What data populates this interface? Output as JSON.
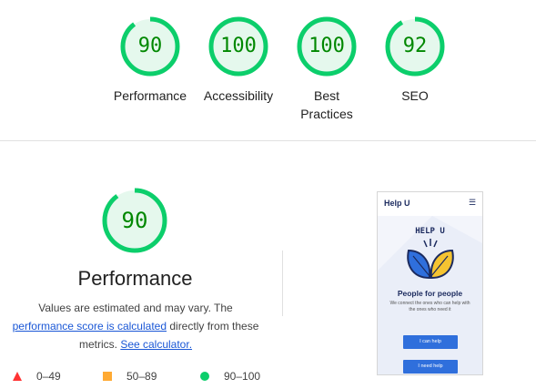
{
  "scores": [
    {
      "label": "Performance",
      "value": "90",
      "score": 90
    },
    {
      "label": "Accessibility",
      "value": "100",
      "score": 100
    },
    {
      "label": "Best Practices",
      "value": "100",
      "score": 100
    },
    {
      "label": "SEO",
      "value": "92",
      "score": 92
    }
  ],
  "performance": {
    "value": "90",
    "score": 90,
    "title": "Performance",
    "desc_part1": "Values are estimated and may vary. The ",
    "desc_link1": "performance score is calculated",
    "desc_part2": " directly from these metrics. ",
    "desc_link2": "See calculator."
  },
  "legend": [
    {
      "range": "0–49",
      "shape": "triangle",
      "color": "#ff3333"
    },
    {
      "range": "50–89",
      "shape": "square",
      "color": "#ffaa33"
    },
    {
      "range": "90–100",
      "shape": "circle",
      "color": "#0cce6b"
    }
  ],
  "colors": {
    "pass_ring": "#0cce6b",
    "pass_fill": "#e5f8ed",
    "pass_text": "#008800",
    "link": "#1a57d6"
  },
  "thumbnail": {
    "brand": "Help U",
    "menu_icon": "hamburger-icon",
    "logo_text": "HELP U",
    "heading": "People for people",
    "subtext": "We connect the ones who can help with the ones who need it",
    "button1": "I can help",
    "button2": "I need help"
  }
}
